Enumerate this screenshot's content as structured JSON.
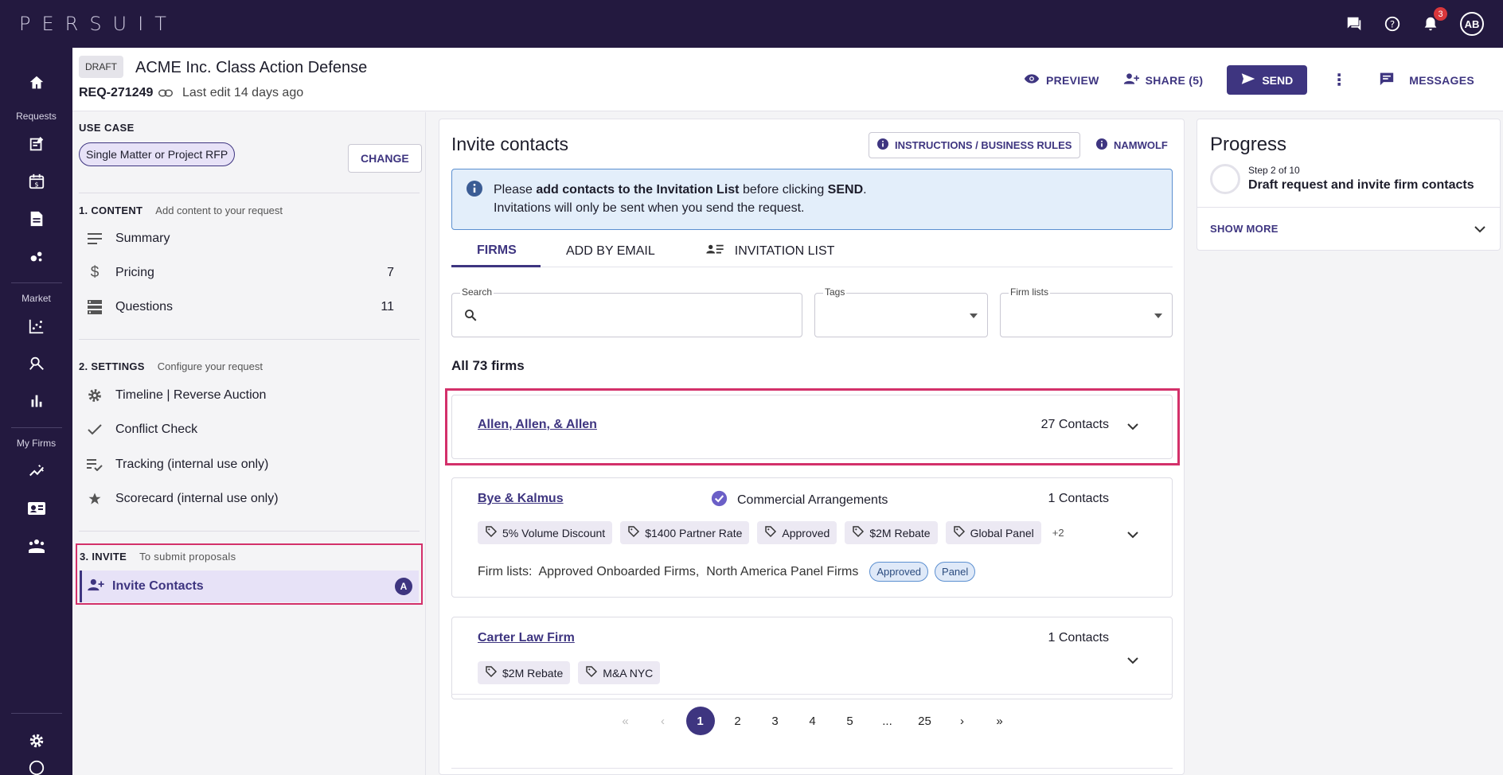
{
  "app": {
    "logo": "PERSUIT",
    "notification_count": "3",
    "avatar_initials": "AB"
  },
  "rail": {
    "requests_label": "Requests",
    "market_label": "Market",
    "myfirms_label": "My Firms"
  },
  "header": {
    "status": "DRAFT",
    "title": "ACME Inc. Class Action Defense",
    "req_id": "REQ-271249",
    "last_edit": "Last edit 14 days ago",
    "preview": "PREVIEW",
    "share": "SHARE (5)",
    "send": "SEND",
    "messages": "MESSAGES"
  },
  "sidebar": {
    "use_case_label": "USE CASE",
    "use_case_value": "Single Matter or Project RFP",
    "change": "CHANGE",
    "content": {
      "title": "1. CONTENT",
      "sub": "Add content to your request",
      "items": [
        {
          "label": "Summary",
          "count": ""
        },
        {
          "label": "Pricing",
          "count": "7"
        },
        {
          "label": "Questions",
          "count": "11"
        }
      ]
    },
    "settings": {
      "title": "2. SETTINGS",
      "sub": "Configure your request",
      "items": [
        {
          "label": "Timeline | Reverse Auction"
        },
        {
          "label": "Conflict Check"
        },
        {
          "label": "Tracking (internal use only)"
        },
        {
          "label": "Scorecard (internal use only)"
        }
      ]
    },
    "invite": {
      "title": "3. INVITE",
      "sub": "To submit proposals",
      "item": "Invite Contacts",
      "item_badge": "A"
    }
  },
  "main": {
    "title": "Invite contacts",
    "instructions": "INSTRUCTIONS / BUSINESS RULES",
    "namwolf": "NAMWOLF",
    "info_pre": "Please ",
    "info_bold": "add contacts to the Invitation List",
    "info_mid": " before clicking ",
    "info_send": "SEND",
    "info_end": ".",
    "info_line2": "Invitations will only be sent when you send the request.",
    "tabs": [
      "FIRMS",
      "ADD BY EMAIL",
      "INVITATION LIST"
    ],
    "search_label": "Search",
    "search_value": "",
    "tags_label": "Tags",
    "firmlists_label": "Firm lists",
    "all_firms": "All 73 firms",
    "firms": [
      {
        "name": "Allen, Allen, & Allen",
        "contacts": "27 Contacts"
      },
      {
        "name": "Bye & Kalmus",
        "contacts": "1 Contacts",
        "arrangement": "Commercial Arrangements",
        "tags": [
          "5% Volume Discount",
          "$1400 Partner Rate",
          "Approved",
          "$2M Rebate",
          "Global Panel"
        ],
        "more": "+2",
        "firm_lists_label": "Firm lists:",
        "firm_lists": "Approved Onboarded Firms,  North America Panel Firms",
        "pills": [
          "Approved",
          "Panel"
        ]
      },
      {
        "name": "Carter Law Firm",
        "contacts": "1 Contacts",
        "tags": [
          "$2M Rebate",
          "M&A NYC"
        ]
      }
    ],
    "pager": {
      "pages": [
        "1",
        "2",
        "3",
        "4",
        "5",
        "...",
        "25"
      ]
    }
  },
  "progress": {
    "title": "Progress",
    "step": "Step 2 of 10",
    "desc": "Draft request and invite firm contacts",
    "more": "SHOW MORE"
  },
  "colors": {
    "brand_dark": "#23193f",
    "accent": "#3e3580",
    "highlight": "#d3306a",
    "info_bg": "#e3eefa"
  }
}
